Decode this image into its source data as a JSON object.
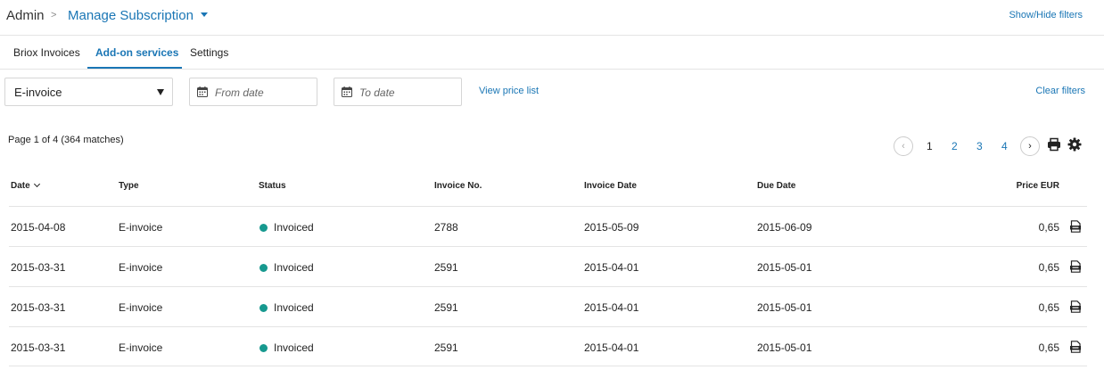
{
  "breadcrumb": {
    "root": "Admin",
    "separator": ">",
    "current": "Manage Subscription"
  },
  "header": {
    "toggle_filters": "Show/Hide filters"
  },
  "tabs": [
    {
      "label": "Briox Invoices",
      "active": false
    },
    {
      "label": "Add-on services",
      "active": true
    },
    {
      "label": "Settings",
      "active": false
    }
  ],
  "filters": {
    "type_selected": "E-invoice",
    "from_date_placeholder": "From date",
    "to_date_placeholder": "To date",
    "view_price_list": "View price list",
    "clear_filters": "Clear filters"
  },
  "pagination": {
    "summary": "Page 1 of 4  (364 matches)",
    "prev": "‹",
    "next": "›",
    "pages": [
      "1",
      "2",
      "3",
      "4"
    ],
    "current": "1"
  },
  "table": {
    "columns": [
      "Date",
      "Type",
      "Status",
      "Invoice No.",
      "Invoice Date",
      "Due Date",
      "Price EUR"
    ],
    "rows": [
      {
        "date": "2015-04-08",
        "type": "E-invoice",
        "status": "Invoiced",
        "invoice_no": "2788",
        "invoice_date": "2015-05-09",
        "due_date": "2015-06-09",
        "price": "0,65"
      },
      {
        "date": "2015-03-31",
        "type": "E-invoice",
        "status": "Invoiced",
        "invoice_no": "2591",
        "invoice_date": "2015-04-01",
        "due_date": "2015-05-01",
        "price": "0,65"
      },
      {
        "date": "2015-03-31",
        "type": "E-invoice",
        "status": "Invoiced",
        "invoice_no": "2591",
        "invoice_date": "2015-04-01",
        "due_date": "2015-05-01",
        "price": "0,65"
      },
      {
        "date": "2015-03-31",
        "type": "E-invoice",
        "status": "Invoiced",
        "invoice_no": "2591",
        "invoice_date": "2015-04-01",
        "due_date": "2015-05-01",
        "price": "0,65"
      }
    ]
  },
  "colors": {
    "accent": "#1a76b5",
    "status_invoiced": "#17998f",
    "border": "#e4e4e4"
  },
  "icons": [
    "chevron-down-icon",
    "calendar-icon",
    "print-icon",
    "gear-icon",
    "pdf-icon",
    "sort-chevron-icon"
  ]
}
